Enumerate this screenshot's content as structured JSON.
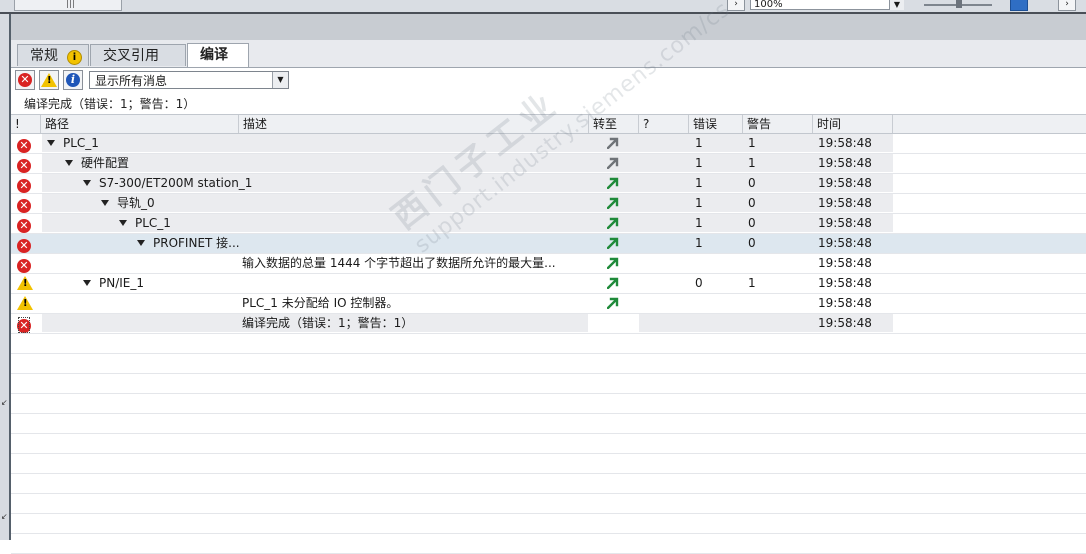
{
  "toolbar_top": {
    "zoom_value": "100%"
  },
  "tabs": [
    {
      "label": "常规",
      "badge": "i"
    },
    {
      "label": "交叉引用"
    },
    {
      "label": "编译"
    }
  ],
  "toolbar": {
    "filter_value": "显示所有消息"
  },
  "summary": "编译完成（错误：1；警告：1）",
  "columns": {
    "flag": "!",
    "path": "路径",
    "desc": "描述",
    "goto": "转至",
    "q": "?",
    "errors": "错误",
    "warnings": "警告",
    "time": "时间"
  },
  "rows": [
    {
      "icon": "error",
      "path": "PLC_1",
      "desc": "",
      "goto": true,
      "errors": "1",
      "warnings": "1",
      "time": "19:58:48"
    },
    {
      "icon": "error",
      "path": "硬件配置",
      "desc": "",
      "goto": true,
      "errors": "1",
      "warnings": "1",
      "time": "19:58:48"
    },
    {
      "icon": "error",
      "path": "S7-300/ET200M station_1",
      "desc": "",
      "goto": true,
      "errors": "1",
      "warnings": "0",
      "time": "19:58:48"
    },
    {
      "icon": "error",
      "path": "导轨_0",
      "desc": "",
      "goto": true,
      "errors": "1",
      "warnings": "0",
      "time": "19:58:48"
    },
    {
      "icon": "error",
      "path": "PLC_1",
      "desc": "",
      "goto": true,
      "errors": "1",
      "warnings": "0",
      "time": "19:58:48"
    },
    {
      "icon": "error",
      "path": "PROFINET 接...",
      "desc": "",
      "goto": true,
      "errors": "1",
      "warnings": "0",
      "time": "19:58:48"
    },
    {
      "icon": "error",
      "path": "",
      "desc": "输入数据的总量 1444 个字节超出了数据所允许的最大量...",
      "goto": true,
      "errors": "",
      "warnings": "",
      "time": "19:58:48"
    },
    {
      "icon": "warning",
      "path": "PN/IE_1",
      "desc": "",
      "goto": true,
      "errors": "0",
      "warnings": "1",
      "time": "19:58:48"
    },
    {
      "icon": "warning",
      "path": "",
      "desc": "PLC_1 未分配给 IO 控制器。",
      "goto": true,
      "errors": "",
      "warnings": "",
      "time": "19:58:48"
    },
    {
      "icon": "error",
      "path": "",
      "desc": "编译完成（错误：1；警告：1）",
      "goto": false,
      "errors": "",
      "warnings": "",
      "time": "19:58:48"
    }
  ],
  "watermark": {
    "line1": "西门子工业",
    "line2": "support.industry.siemens.com/cs"
  },
  "colors": {
    "error": "#d92323",
    "warning": "#f2c200",
    "info": "#1f56b8",
    "goto_dark": "#6f7378",
    "goto_green": "#1f8a3a"
  }
}
